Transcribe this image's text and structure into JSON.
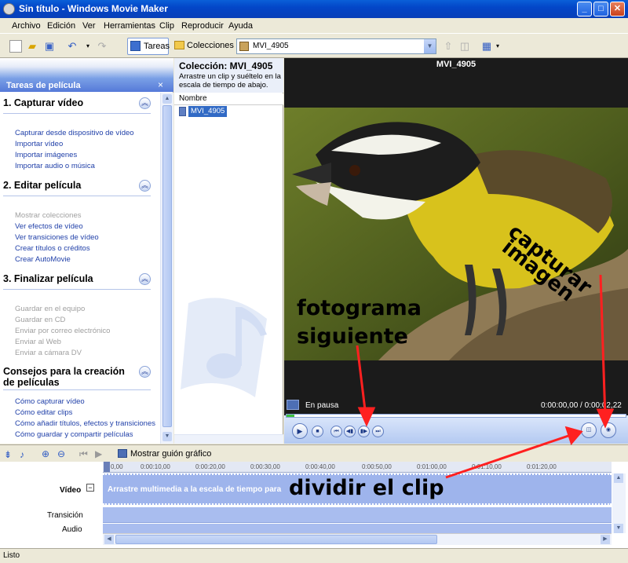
{
  "window": {
    "title": "Sin título - Windows Movie Maker"
  },
  "menu": [
    "Archivo",
    "Edición",
    "Ver",
    "Herramientas",
    "Clip",
    "Reproducir",
    "Ayuda"
  ],
  "toolbar": {
    "tareas": "Tareas",
    "colecciones": "Colecciones",
    "collection_value": "MVI_4905"
  },
  "tasks_panel": {
    "title": "Tareas de película",
    "sections": [
      {
        "title": "1. Capturar vídeo",
        "items": [
          {
            "label": "Capturar desde dispositivo de vídeo",
            "enabled": true
          },
          {
            "label": "Importar vídeo",
            "enabled": true
          },
          {
            "label": "Importar imágenes",
            "enabled": true
          },
          {
            "label": "Importar audio o música",
            "enabled": true
          }
        ]
      },
      {
        "title": "2. Editar película",
        "items": [
          {
            "label": "Mostrar colecciones",
            "enabled": false
          },
          {
            "label": "Ver efectos de vídeo",
            "enabled": true
          },
          {
            "label": "Ver transiciones de vídeo",
            "enabled": true
          },
          {
            "label": "Crear títulos o créditos",
            "enabled": true
          },
          {
            "label": "Crear AutoMovie",
            "enabled": true
          }
        ]
      },
      {
        "title": "3. Finalizar película",
        "items": [
          {
            "label": "Guardar en el equipo",
            "enabled": false
          },
          {
            "label": "Guardar en CD",
            "enabled": false
          },
          {
            "label": "Enviar por correo electrónico",
            "enabled": false
          },
          {
            "label": "Enviar al Web",
            "enabled": false
          },
          {
            "label": "Enviar a cámara DV",
            "enabled": false
          }
        ]
      },
      {
        "title": "Consejos para la creación de películas",
        "items": [
          {
            "label": "Cómo capturar vídeo",
            "enabled": true
          },
          {
            "label": "Cómo editar clips",
            "enabled": true
          },
          {
            "label": "Cómo añadir títulos, efectos y transiciones",
            "enabled": true
          },
          {
            "label": "Cómo guardar y compartir películas",
            "enabled": true
          }
        ]
      }
    ]
  },
  "collection": {
    "title": "Colección: MVI_4905",
    "subtitle": "Arrastre un clip y suéltelo en la escala de tiempo de abajo.",
    "column": "Nombre",
    "clip": "MVI_4905"
  },
  "preview": {
    "title": "MVI_4905",
    "status": "En pausa",
    "time": "0:00:00,00 / 0:00:02,22"
  },
  "timeline": {
    "toolbar_label": "Mostrar guión gráfico",
    "ruler": [
      "0,00",
      "0:00:10,00",
      "0:00:20,00",
      "0:00:30,00",
      "0:00:40,00",
      "0:00:50,00",
      "0:01:00,00",
      "0:01:10,00",
      "0:01:20,00"
    ],
    "tracks": {
      "video": "Vídeo",
      "transition": "Transición",
      "audio": "Audio"
    },
    "video_hint": "Arrastre multimedia a la escala de tiempo para"
  },
  "annotations": {
    "fotograma": "fotograma",
    "siguiente": "siguiente",
    "capturar": "capturar",
    "imagen": "imagen",
    "dividir": "dividir el clip"
  },
  "status": "Listo"
}
